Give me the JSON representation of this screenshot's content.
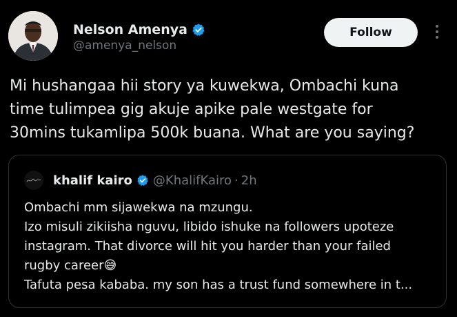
{
  "author": {
    "name": "Nelson Amenya",
    "handle": "@amenya_nelson",
    "verified": true
  },
  "follow_label": "Follow",
  "more_icon": "more-vertical-icon",
  "tweet_text": "Mi hushangaa hii story ya kuwekwa, Ombachi kuna\ntime tulimpea gig akuje apike pale westgate for\n30mins tukamlipa 500k buana. What are you saying?",
  "quote": {
    "name": "khalif kairo",
    "handle": "@KhalifKairo",
    "separator": "·",
    "time": "2h",
    "verified": true,
    "text": "Ombachi mm sijawekwa na mzungu.\nIzo misuli zikiisha nguvu, libido ishuke na followers upoteze\ninstagram. That divorce will hit you harder than your failed\nrugby career😅\nTafuta pesa kababa. my son has a trust fund somewhere in t..."
  },
  "colors": {
    "background": "#000000",
    "text": "#e7e9ea",
    "muted": "#71767b",
    "verified": "#1d9bf0",
    "follow_bg": "#eff3f4",
    "border": "#2f3336"
  }
}
